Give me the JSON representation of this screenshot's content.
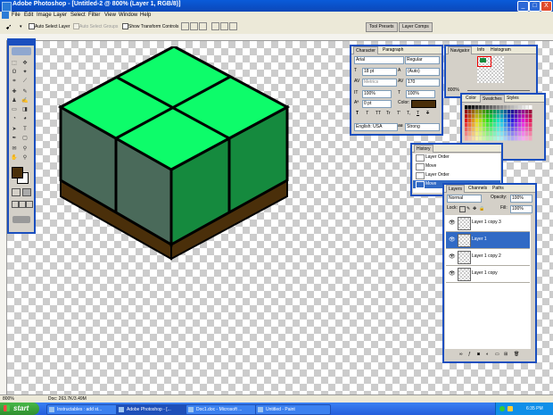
{
  "window": {
    "title": "Adobe Photoshop - [Untitled-2 @ 800% (Layer 1, RGB/8)]",
    "minimize": "_",
    "maximize": "□",
    "close": "X"
  },
  "menu": [
    "File",
    "Edit",
    "Image",
    "Layer",
    "Select",
    "Filter",
    "View",
    "Window",
    "Help"
  ],
  "options_bar": {
    "auto_select_layer": "Auto Select Layer",
    "auto_select_groups": "Auto Select Groups",
    "show_transform": "Show Transform Controls",
    "tool_presets": "Tool Presets",
    "layer_comps": "Layer Comps"
  },
  "character_panel": {
    "tabs": [
      "Character",
      "Paragraph"
    ],
    "font_family": "Arial",
    "font_style": "Regular",
    "size": "18 pt",
    "leading": "(Auto)",
    "kerning": "Metrics",
    "tracking": "170",
    "v_scale": "100%",
    "h_scale": "100%",
    "baseline": "0 pt",
    "color_label": "Color:",
    "language": "English: USA",
    "aa_label": "aa",
    "antialias": "Strong",
    "style_buttons": [
      "T",
      "T",
      "TT",
      "Tr",
      "T'",
      "T,",
      "T",
      "T"
    ]
  },
  "navigator": {
    "tabs": [
      "Navigator",
      "Info",
      "Histogram"
    ],
    "zoom": "800%"
  },
  "swatches": {
    "tabs": [
      "Color",
      "Swatches",
      "Styles"
    ]
  },
  "history": {
    "tab": "History",
    "items": [
      "Layer Order",
      "Move",
      "Layer Order",
      "Move"
    ]
  },
  "layers": {
    "tabs": [
      "Layers",
      "Channels",
      "Paths"
    ],
    "blend": "Normal",
    "opacity_label": "Opacity:",
    "opacity": "100%",
    "lock_label": "Lock:",
    "fill_label": "Fill:",
    "fill": "100%",
    "items": [
      "Layer 1 copy 3",
      "Layer 1",
      "Layer 1 copy 2",
      "Layer 1 copy"
    ],
    "selected_index": 1
  },
  "status": {
    "zoom": "800%",
    "doc": "Doc: 263.7K/3.49M"
  },
  "taskbar": {
    "start": "start",
    "tasks": [
      "Instructables : add st...",
      "Adobe Photoshop - [...",
      "Doc1.doc - Microsoft ...",
      "Untitled - Paint"
    ],
    "active_index": 1,
    "time": "6:35 PM"
  },
  "colors": {
    "top_light": "#0dfc6a",
    "side_left": "#4a6a5a",
    "side_right": "#158a3e",
    "dirt": "#4a2f0a",
    "outline": "#000000",
    "foreground": "#4a2f0a",
    "background": "#ffffff"
  }
}
